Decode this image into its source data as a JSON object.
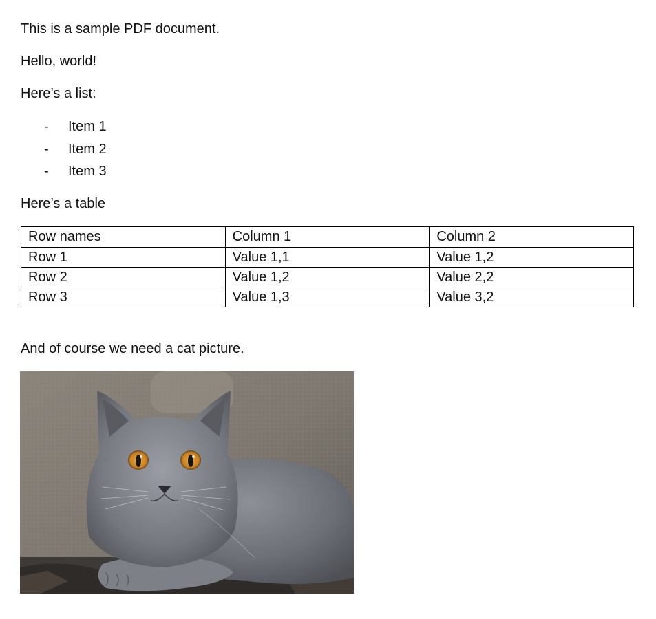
{
  "document": {
    "intro": "This is a sample PDF document.",
    "greeting": "Hello, world!",
    "list_heading": "Here’s a list:",
    "list_items": [
      {
        "bullet": "-",
        "text": "Item 1"
      },
      {
        "bullet": "-",
        "text": "Item 2"
      },
      {
        "bullet": "-",
        "text": "Item 3"
      }
    ],
    "table_heading": "Here’s a table",
    "table": {
      "headers": [
        "Row names",
        "Column 1",
        "Column 2"
      ],
      "rows": [
        [
          "Row 1",
          "Value 1,1",
          "Value 1,2"
        ],
        [
          "Row 2",
          "Value 1,2",
          "Value 2,2"
        ],
        [
          "Row 3",
          "Value 1,3",
          "Value 3,2"
        ]
      ]
    },
    "picture_caption": "And of course we need a cat picture."
  }
}
